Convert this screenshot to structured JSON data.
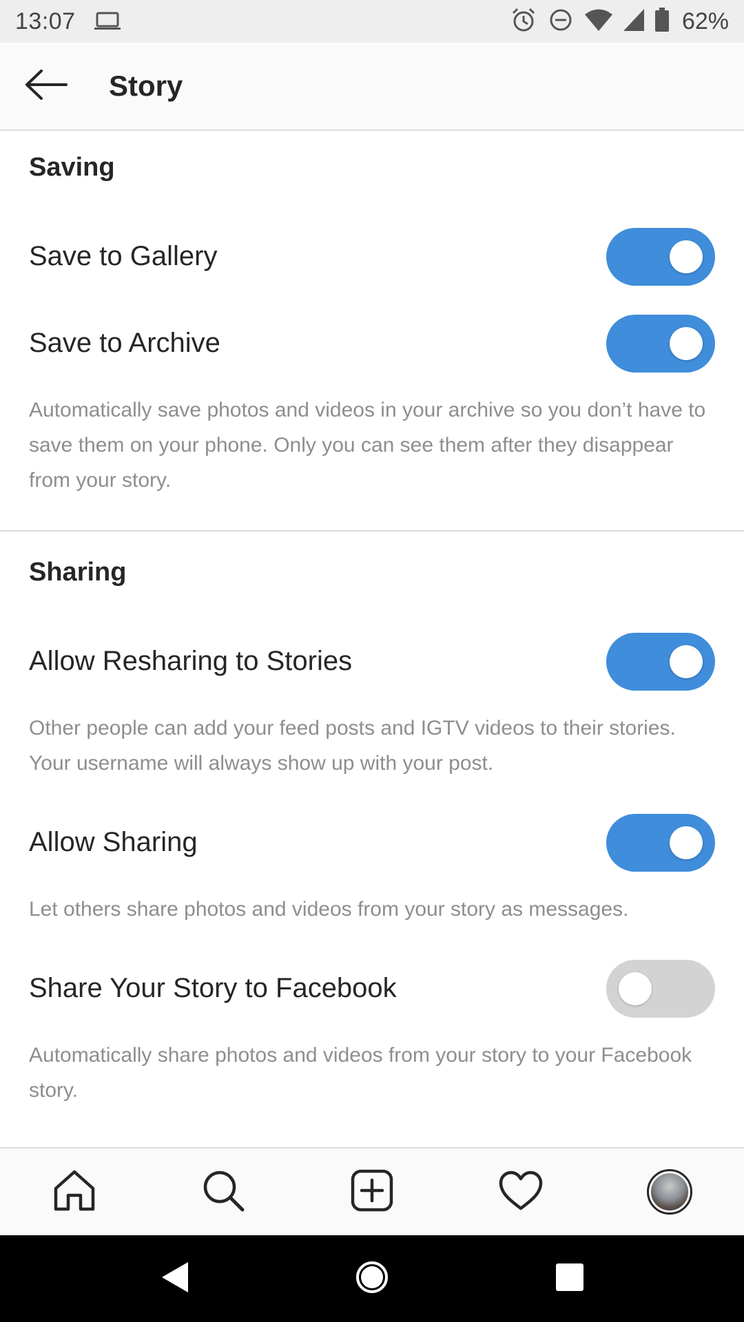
{
  "status_bar": {
    "time": "13:07",
    "battery": "62%",
    "icons": [
      "laptop-icon",
      "alarm-icon",
      "do-not-disturb-icon",
      "wifi-icon",
      "signal-icon",
      "battery-icon"
    ]
  },
  "header": {
    "title": "Story",
    "back_icon": "back-arrow-icon"
  },
  "sections": {
    "saving": {
      "title": "Saving",
      "save_to_gallery": {
        "label": "Save to Gallery",
        "enabled": true
      },
      "save_to_archive": {
        "label": "Save to Archive",
        "enabled": true,
        "description": "Automatically save photos and videos in your archive so you don’t have to save them on your phone. Only you can see them after they disappear from your story."
      }
    },
    "sharing": {
      "title": "Sharing",
      "allow_resharing": {
        "label": "Allow Resharing to Stories",
        "enabled": true,
        "description": "Other people can add your feed posts and IGTV videos to their stories. Your username will always show up with your post."
      },
      "allow_sharing": {
        "label": "Allow Sharing",
        "enabled": true,
        "description": "Let others share photos and videos from your story as messages."
      },
      "share_to_facebook": {
        "label": "Share Your Story to Facebook",
        "enabled": false,
        "description": "Automatically share photos and videos from your story to your Facebook story."
      }
    }
  },
  "tab_bar": {
    "items": [
      "home-icon",
      "search-icon",
      "new-post-icon",
      "activity-heart-icon",
      "profile-avatar"
    ]
  },
  "nav_bar": {
    "items": [
      "nav-back-icon",
      "nav-home-icon",
      "nav-recents-icon"
    ]
  },
  "colors": {
    "toggle_on": "#3f8ddb",
    "toggle_off": "#d3d3d3",
    "text_primary": "#262626",
    "text_secondary": "#8e8e8e",
    "divider": "#dbdbdb"
  }
}
